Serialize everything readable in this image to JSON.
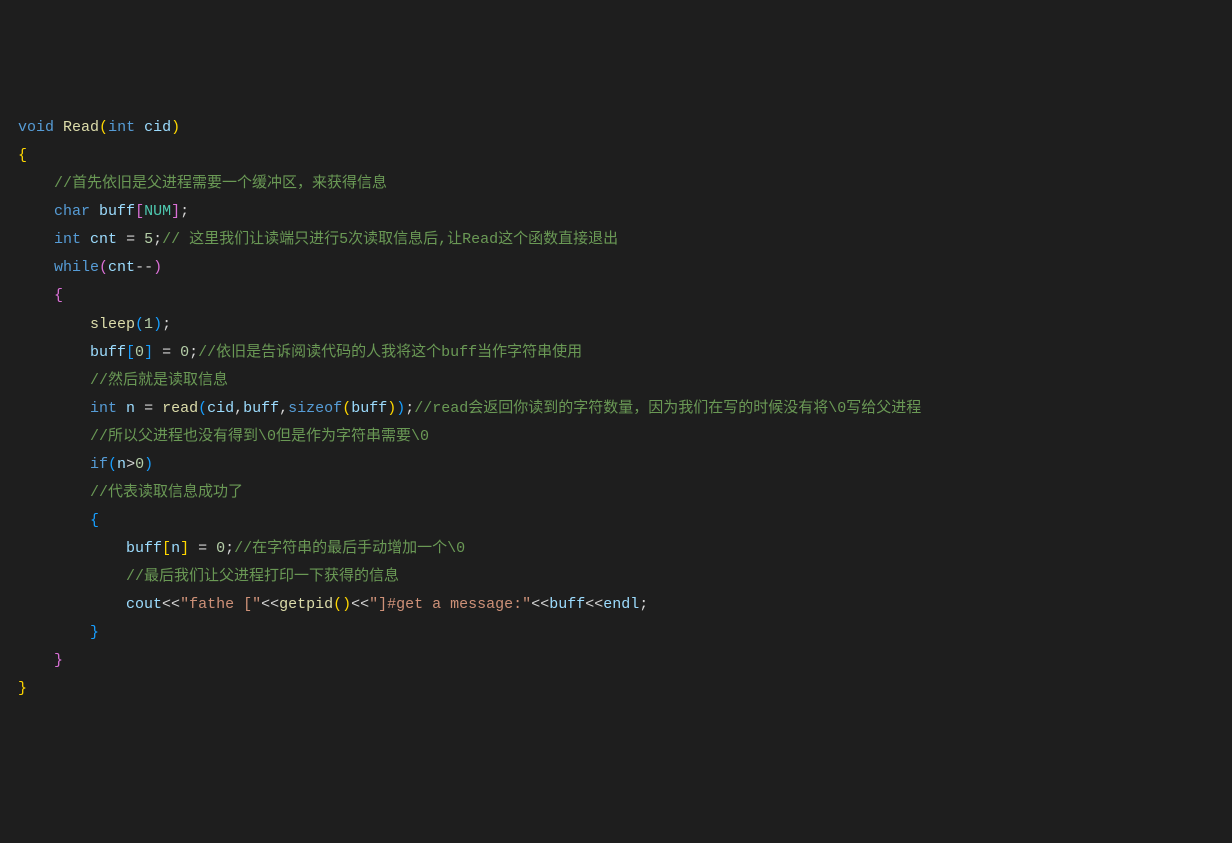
{
  "code": {
    "l1": {
      "kw_void": "void",
      "fn_read": "Read",
      "kw_int": "int",
      "var_cid": "cid"
    },
    "l2_brace": "{",
    "l3_comment": "//首先依旧是父进程需要一个缓冲区，来获得信息",
    "l4": {
      "kw_char": "char",
      "var_buff": "buff",
      "macro_num": "NUM"
    },
    "l5": {
      "kw_int": "int",
      "var_cnt": "cnt",
      "eq": " = ",
      "num_5": "5",
      "semi": ";",
      "comment": "// 这里我们让读端只进行5次读取信息后,让Read这个函数直接退出"
    },
    "l6": {
      "kw_while": "while",
      "var_cnt": "cnt",
      "op": "--"
    },
    "l7_brace": "{",
    "l8": {
      "fn_sleep": "sleep",
      "num_1": "1"
    },
    "l9": {
      "var_buff": "buff",
      "num_0a": "0",
      "eq": " = ",
      "num_0b": "0",
      "semi": ";",
      "comment": "//依旧是告诉阅读代码的人我将这个buff当作字符串使用"
    },
    "l10_comment": "//然后就是读取信息",
    "l11": {
      "kw_int": "int",
      "var_n": "n",
      "eq": " = ",
      "fn_read": "read",
      "var_cid": "cid",
      "var_buff1": "buff",
      "kw_sizeof": "sizeof",
      "var_buff2": "buff",
      "semi": ";",
      "comment": "//read会返回你读到的字符数量，因为我们在写的时候没有将\\0写给父进程"
    },
    "l12_comment": "//所以父进程也没有得到\\0但是作为字符串需要\\0",
    "l13": {
      "kw_if": "if",
      "var_n": "n",
      "op": ">",
      "num_0": "0"
    },
    "l14_comment": "//代表读取信息成功了",
    "l15_brace": "{",
    "l16": {
      "var_buff": "buff",
      "var_n": "n",
      "eq": " = ",
      "num_0": "0",
      "semi": ";",
      "comment": "//在字符串的最后手动增加一个\\0"
    },
    "l17_comment": "//最后我们让父进程打印一下获得的信息",
    "l18": {
      "var_cout": "cout",
      "op1": "<<",
      "str1": "\"fathe [\"",
      "op2": "<<",
      "fn_getpid": "getpid",
      "op3": "<<",
      "str2": "\"]#get a message:\"",
      "op4": "<<",
      "var_buff": "buff",
      "op5": "<<",
      "var_endl": "endl",
      "semi": ";"
    },
    "l19_brace": "}",
    "l20_brace": "}",
    "l21_brace": "}"
  }
}
